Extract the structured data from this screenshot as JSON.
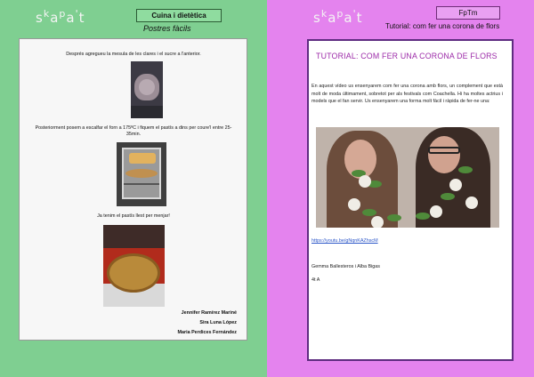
{
  "left_page": {
    "logo": [
      "s",
      "k",
      "a",
      "p",
      "a",
      "'",
      "t"
    ],
    "label": "Cuina i dietètica",
    "subtitle": "Postres fàcils",
    "captions": [
      "Després agregueu la mesula de les clares i el sucre a l'anterior.",
      "Posteriorment posem a escalfar el forn a 175ºC i fiquem el pastís a dins per coure'l entre 25-35min.",
      "Ja tenim el pastís llest per menjar!"
    ],
    "signatures": [
      "Jennifer Ramírez Mariné",
      "Sira Luna López",
      "Maria Perdices Fernández"
    ]
  },
  "right_page": {
    "logo": [
      "s",
      "k",
      "a",
      "p",
      "a",
      "'",
      "t"
    ],
    "label": "FpTm",
    "subtitle": "Tutorial: com fer una corona de flors",
    "title": "TUTORIAL: COM FER UNA CORONA DE FLORS",
    "paragraph": "En aquest vídeo us ensenyarem com fer una corona amb flors, un complement que està molt de moda últimament, sobretot per als festivals com Coachella. Hi ha moltes actrius i models que el fan servir. Us ensenyarem una forma molt fàcil i ràpida de fer-ne una:",
    "link": "https://youtu.be/gNqnKAZhscM",
    "authors": "Gemma Ballesteros i Alba Bigas",
    "grade": "4t A"
  },
  "colors": {
    "left_background": "#7fcf91",
    "right_background": "#e483ee",
    "title_accent": "#9c2aa8",
    "link": "#2a55c8"
  }
}
